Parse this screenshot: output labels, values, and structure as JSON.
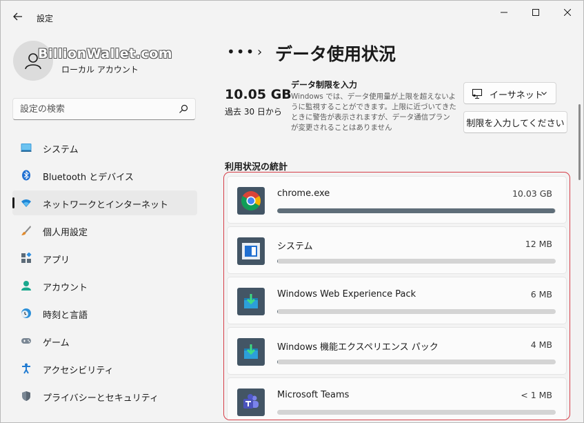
{
  "window": {
    "app_title": "設定",
    "controls": {
      "minimize": "minimize-icon",
      "maximize": "maximize-icon",
      "close": "close-icon"
    }
  },
  "profile": {
    "name": "",
    "account_type": "ローカル アカウント",
    "watermark": "BillionWallet.com"
  },
  "search": {
    "placeholder": "設定の検索",
    "value": ""
  },
  "sidebar": {
    "items": [
      {
        "label": "システム",
        "icon": "system-icon",
        "active": false
      },
      {
        "label": "Bluetooth とデバイス",
        "icon": "bluetooth-icon",
        "active": false
      },
      {
        "label": "ネットワークとインターネット",
        "icon": "wifi-icon",
        "active": true
      },
      {
        "label": "個人用設定",
        "icon": "brush-icon",
        "active": false
      },
      {
        "label": "アプリ",
        "icon": "apps-icon",
        "active": false
      },
      {
        "label": "アカウント",
        "icon": "account-icon",
        "active": false
      },
      {
        "label": "時刻と言語",
        "icon": "time-language-icon",
        "active": false
      },
      {
        "label": "ゲーム",
        "icon": "gamepad-icon",
        "active": false
      },
      {
        "label": "アクセシビリティ",
        "icon": "accessibility-icon",
        "active": false
      },
      {
        "label": "プライバシーとセキュリティ",
        "icon": "shield-icon",
        "active": false
      }
    ]
  },
  "header": {
    "more": "•••",
    "separator": "›",
    "title": "データ使用状況"
  },
  "usage": {
    "total": "10.05 GB",
    "period": "過去 30 日から",
    "limit_heading": "データ制限を入力",
    "limit_description": "Windows では、データ使用量が上限を超えないように監視することができます。上限に近づいてきたときに警告が表示されますが、データ通信プランが変更されることはありません"
  },
  "network_select": {
    "value": "イーサネット",
    "icon": "ethernet-icon"
  },
  "limit_button": {
    "label": "制限を入力してください"
  },
  "stats": {
    "heading": "利用状況の統計",
    "apps": [
      {
        "name": "chrome.exe",
        "size": "10.03 GB",
        "fraction": 0.998,
        "icon": "chrome-icon"
      },
      {
        "name": "システム",
        "size": "12 MB",
        "fraction": 0.0012,
        "icon": "system-app-icon"
      },
      {
        "name": "Windows Web Experience Pack",
        "size": "6 MB",
        "fraction": 0.0006,
        "icon": "package-icon"
      },
      {
        "name": "Windows 機能エクスペリエンス パック",
        "size": "4 MB",
        "fraction": 0.0004,
        "icon": "package-icon"
      },
      {
        "name": "Microsoft Teams",
        "size": "< 1 MB",
        "fraction": 0.0001,
        "icon": "teams-icon"
      }
    ]
  }
}
